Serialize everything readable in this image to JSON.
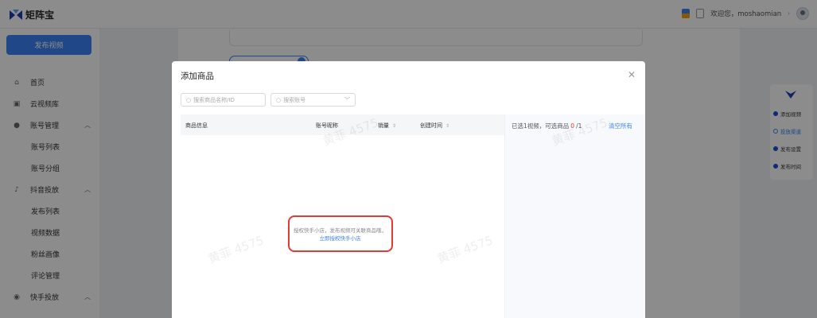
{
  "app": {
    "title": "矩阵宝"
  },
  "topbar": {
    "welcome": "欢迎您，moshaomian"
  },
  "sidebar": {
    "publish_button": "发布视频",
    "items": [
      {
        "label": "首页",
        "icon": "home-icon"
      },
      {
        "label": "云视频库",
        "icon": "library-icon"
      },
      {
        "label": "账号管理",
        "icon": "user-icon",
        "expanded": true
      },
      {
        "label": "账号列表"
      },
      {
        "label": "账号分组"
      },
      {
        "label": "抖音投放",
        "icon": "tiktok-icon",
        "expanded": true
      },
      {
        "label": "发布列表"
      },
      {
        "label": "视频数据"
      },
      {
        "label": "粉丝画像"
      },
      {
        "label": "评论管理"
      },
      {
        "label": "快手投放",
        "icon": "kuaishou-icon",
        "expanded": true
      }
    ]
  },
  "right_panel": {
    "items": [
      {
        "label": "添加视频"
      },
      {
        "label": "投放渠道",
        "active": true
      },
      {
        "label": "发布设置"
      },
      {
        "label": "发布时间"
      }
    ]
  },
  "modal": {
    "title": "添加商品",
    "search_placeholder": "搜索商品名称/ID",
    "account_placeholder": "搜索账号",
    "columns": {
      "product": "商品信息",
      "account": "账号昵称",
      "sales": "销量",
      "created": "创建时间"
    },
    "empty": {
      "message": "授权快手小店，发布视频可关联商品哦，",
      "link": "立即授权快手小店"
    },
    "selection": {
      "prefix": "已选1视频，可选商品",
      "selected": "0",
      "total": "/1",
      "clear": "清空所有"
    }
  },
  "watermark": "黄菲 4575",
  "colors": {
    "accent": "#3b82f6",
    "highlight": "#e53935"
  }
}
